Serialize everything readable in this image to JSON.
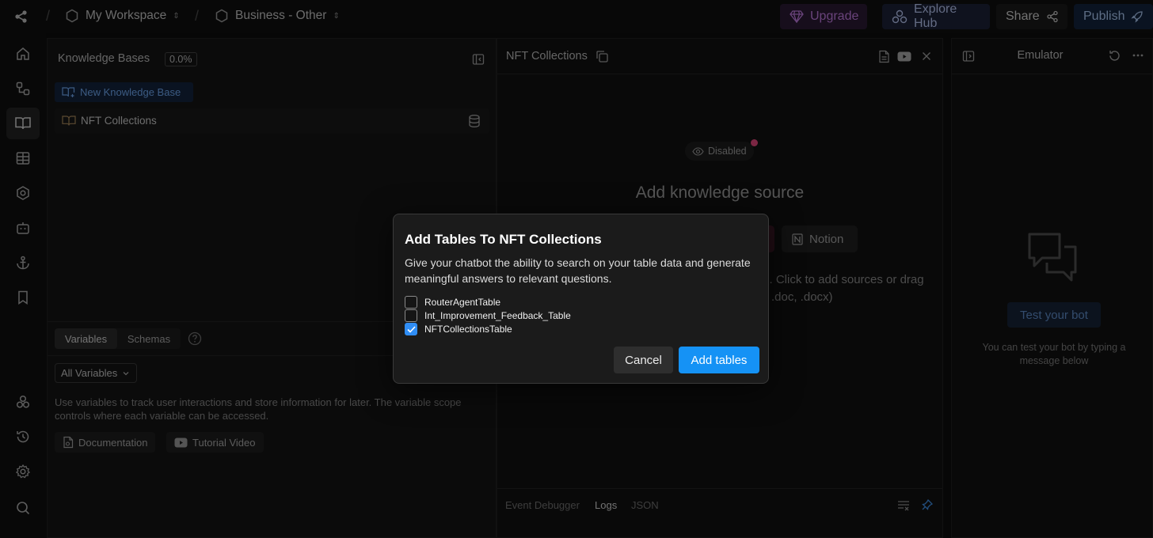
{
  "topbar": {
    "workspace": "My Workspace",
    "project": "Business - Other",
    "upgrade": "Upgrade",
    "explore_hub": "Explore Hub",
    "share": "Share",
    "publish": "Publish"
  },
  "rail": {
    "icons": [
      "home-icon",
      "flow-icon",
      "book-icon",
      "table-icon",
      "hexagon-icon",
      "bot-icon",
      "anchor-icon",
      "bookmark-icon",
      "integrations-icon",
      "history-icon",
      "settings-icon",
      "search-icon"
    ]
  },
  "knowledge": {
    "title": "Knowledge Bases",
    "usage": "0.0%",
    "new_button": "New Knowledge Base",
    "items": [
      {
        "label": "NFT Collections"
      }
    ]
  },
  "variables": {
    "tabs": [
      "Variables",
      "Schemas"
    ],
    "filter": "All Variables",
    "description": "Use variables to track user interactions and store information for later. The variable scope controls where each variable can be accessed.",
    "documentation": "Documentation",
    "tutorial": "Tutorial Video"
  },
  "mid": {
    "title": "NFT Collections",
    "status": "Disabled",
    "heading": "Add knowledge source",
    "notion": "Notion",
    "hint_line1": "s. Click to add sources or drag",
    "hint_line2": ".doc, .docx)",
    "debug_tabs": [
      "Event Debugger",
      "Logs",
      "JSON"
    ]
  },
  "emulator": {
    "title": "Emulator",
    "test_button": "Test your bot",
    "hint": "You can test your bot by typing a message below"
  },
  "modal": {
    "title": "Add Tables To NFT Collections",
    "description": "Give your chatbot the ability to search on your table data and generate meaningful answers to relevant questions.",
    "tables": [
      {
        "label": "RouterAgentTable",
        "checked": false
      },
      {
        "label": "Int_Improvement_Feedback_Table",
        "checked": false
      },
      {
        "label": "NFTCollectionsTable",
        "checked": true
      }
    ],
    "cancel": "Cancel",
    "confirm": "Add tables"
  },
  "colors": {
    "accent": "#1592f5",
    "upgrade_bg": "#2a1a33",
    "upgrade_fg": "#c07be0",
    "hub_bg": "#1c2238",
    "publish_bg": "#13233d",
    "status_dot": "#e0457b"
  }
}
